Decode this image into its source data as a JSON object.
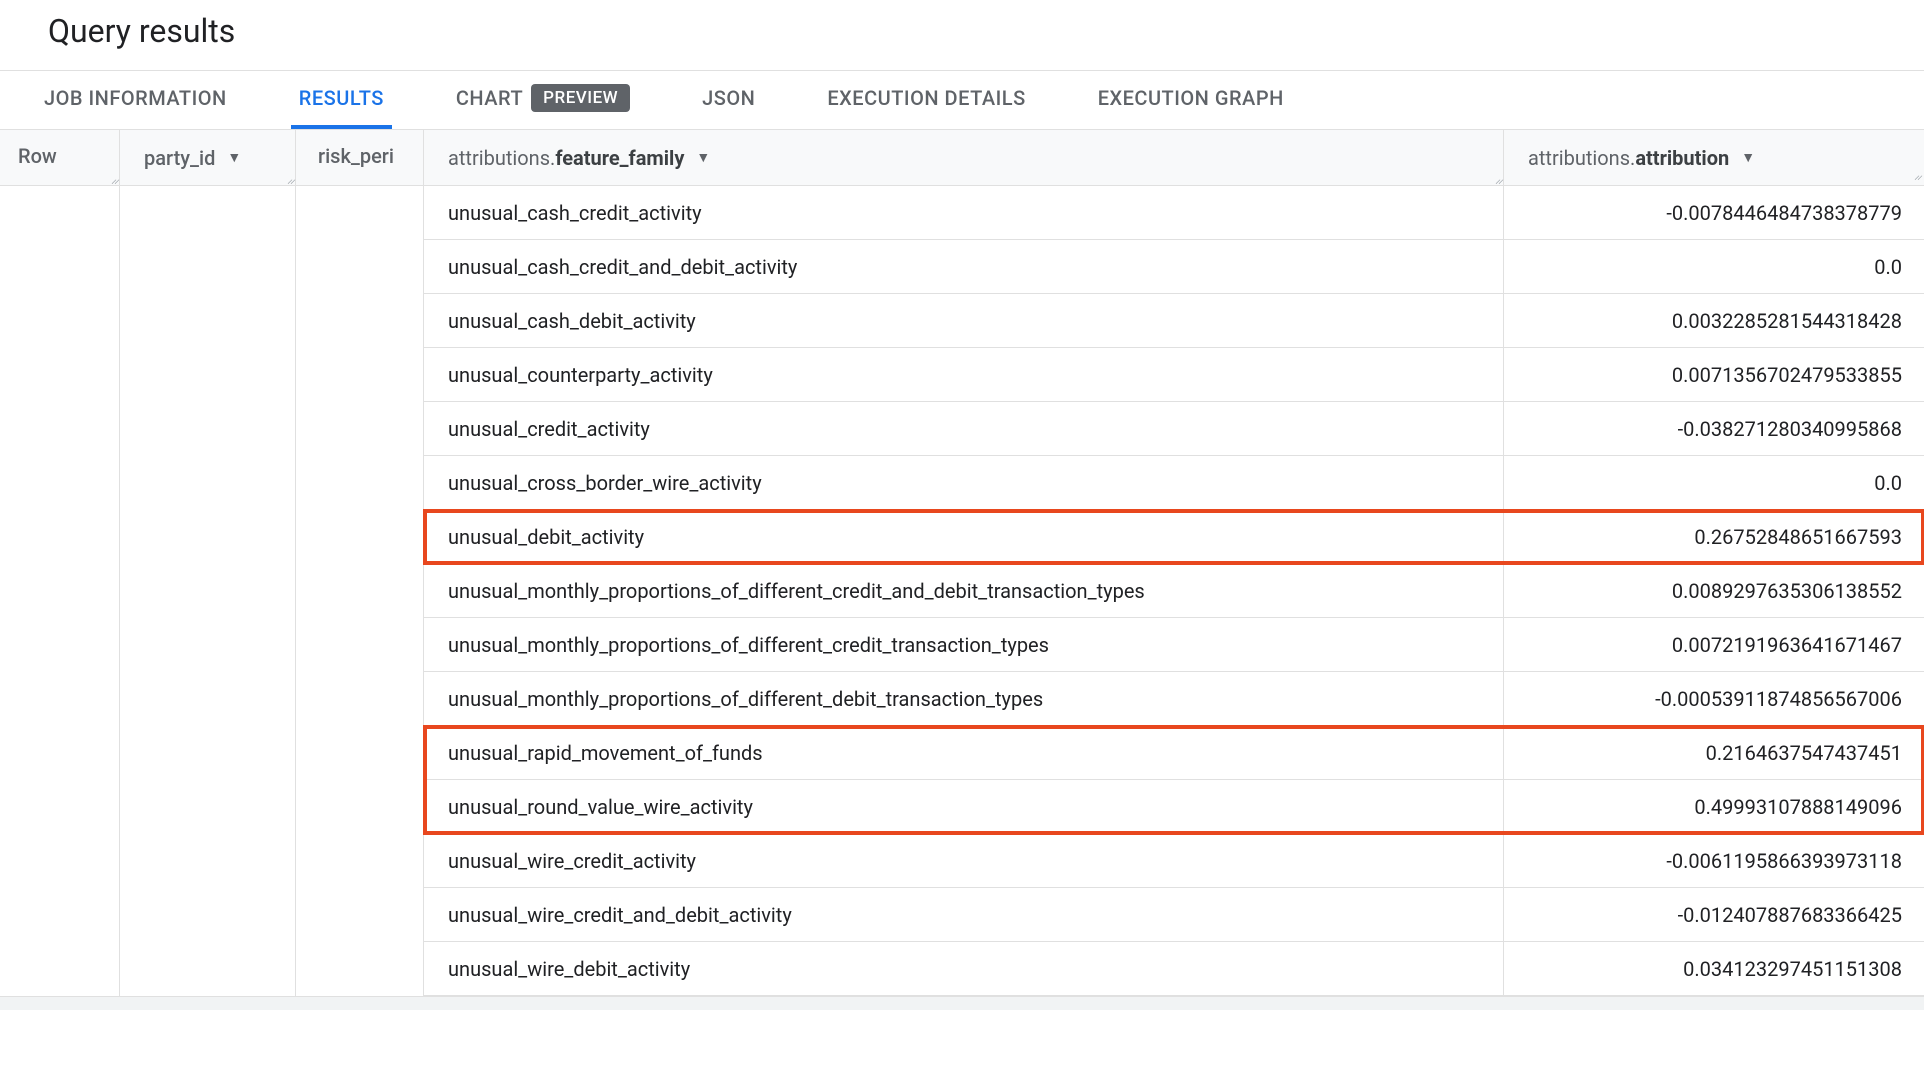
{
  "title": "Query results",
  "tabs": [
    {
      "label": "JOB INFORMATION",
      "active": false,
      "badge": null
    },
    {
      "label": "RESULTS",
      "active": true,
      "badge": null
    },
    {
      "label": "CHART",
      "active": false,
      "badge": "PREVIEW"
    },
    {
      "label": "JSON",
      "active": false,
      "badge": null
    },
    {
      "label": "EXECUTION DETAILS",
      "active": false,
      "badge": null
    },
    {
      "label": "EXECUTION GRAPH",
      "active": false,
      "badge": null
    }
  ],
  "columns": {
    "row": "Row",
    "party_id": "party_id",
    "risk_peri": "risk_peri",
    "feature_prefix": "attributions.",
    "feature_bold": "feature_family",
    "attr_prefix": "attributions.",
    "attr_bold": "attribution"
  },
  "rows": [
    {
      "feature": "unusual_cash_credit_activity",
      "attribution": "-0.0078446484738378779",
      "highlighted": false
    },
    {
      "feature": "unusual_cash_credit_and_debit_activity",
      "attribution": "0.0",
      "highlighted": false
    },
    {
      "feature": "unusual_cash_debit_activity",
      "attribution": "0.0032285281544318428",
      "highlighted": false
    },
    {
      "feature": "unusual_counterparty_activity",
      "attribution": "0.0071356702479533855",
      "highlighted": false
    },
    {
      "feature": "unusual_credit_activity",
      "attribution": "-0.038271280340995868",
      "highlighted": false
    },
    {
      "feature": "unusual_cross_border_wire_activity",
      "attribution": "0.0",
      "highlighted": false
    },
    {
      "feature": "unusual_debit_activity",
      "attribution": "0.26752848651667593",
      "highlighted": true,
      "group": 1
    },
    {
      "feature": "unusual_monthly_proportions_of_different_credit_and_debit_transaction_types",
      "attribution": "0.0089297635306138552",
      "highlighted": false
    },
    {
      "feature": "unusual_monthly_proportions_of_different_credit_transaction_types",
      "attribution": "0.0072191963641671467",
      "highlighted": false
    },
    {
      "feature": "unusual_monthly_proportions_of_different_debit_transaction_types",
      "attribution": "-0.00053911874856567006",
      "highlighted": false
    },
    {
      "feature": "unusual_rapid_movement_of_funds",
      "attribution": "0.2164637547437451",
      "highlighted": true,
      "group": 2
    },
    {
      "feature": "unusual_round_value_wire_activity",
      "attribution": "0.49993107888149096",
      "highlighted": true,
      "group": 2
    },
    {
      "feature": "unusual_wire_credit_activity",
      "attribution": "-0.0061195866393973118",
      "highlighted": false
    },
    {
      "feature": "unusual_wire_credit_and_debit_activity",
      "attribution": "-0.012407887683366425",
      "highlighted": false
    },
    {
      "feature": "unusual_wire_debit_activity",
      "attribution": "0.034123297451151308",
      "highlighted": false
    }
  ]
}
